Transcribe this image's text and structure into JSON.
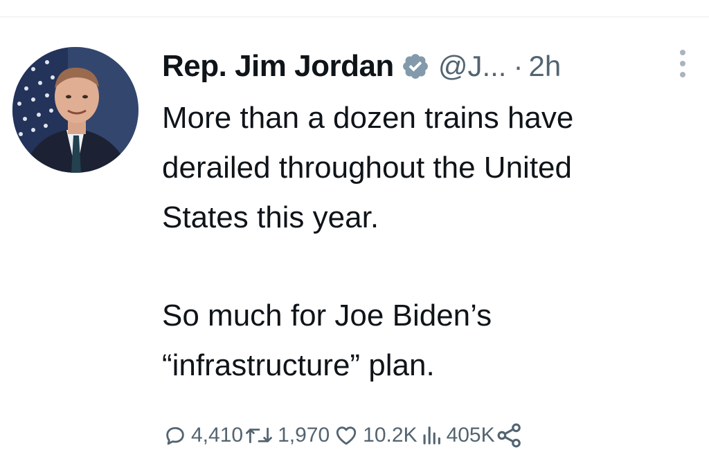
{
  "tweet": {
    "author": {
      "display_name": "Rep. Jim Jordan",
      "handle": "@J...",
      "verified": true
    },
    "separator": "·",
    "timestamp": "2h",
    "text_lines": [
      "More than a dozen trains have",
      "derailed throughout the United",
      "States this year.",
      "",
      "So much for Joe Biden’s",
      "“infrastructure” plan."
    ],
    "stats": {
      "replies": "4,410",
      "retweets": "1,970",
      "likes": "10.2K",
      "views": "405K"
    }
  },
  "icons": {
    "verified": "verified-badge-icon",
    "more": "more-vertical-icon",
    "reply": "reply-icon",
    "retweet": "retweet-icon",
    "like": "heart-icon",
    "views": "views-chart-icon",
    "share": "share-icon"
  },
  "colors": {
    "text": "#0f1419",
    "secondary": "#536471",
    "verified_badge": "#829aab"
  }
}
